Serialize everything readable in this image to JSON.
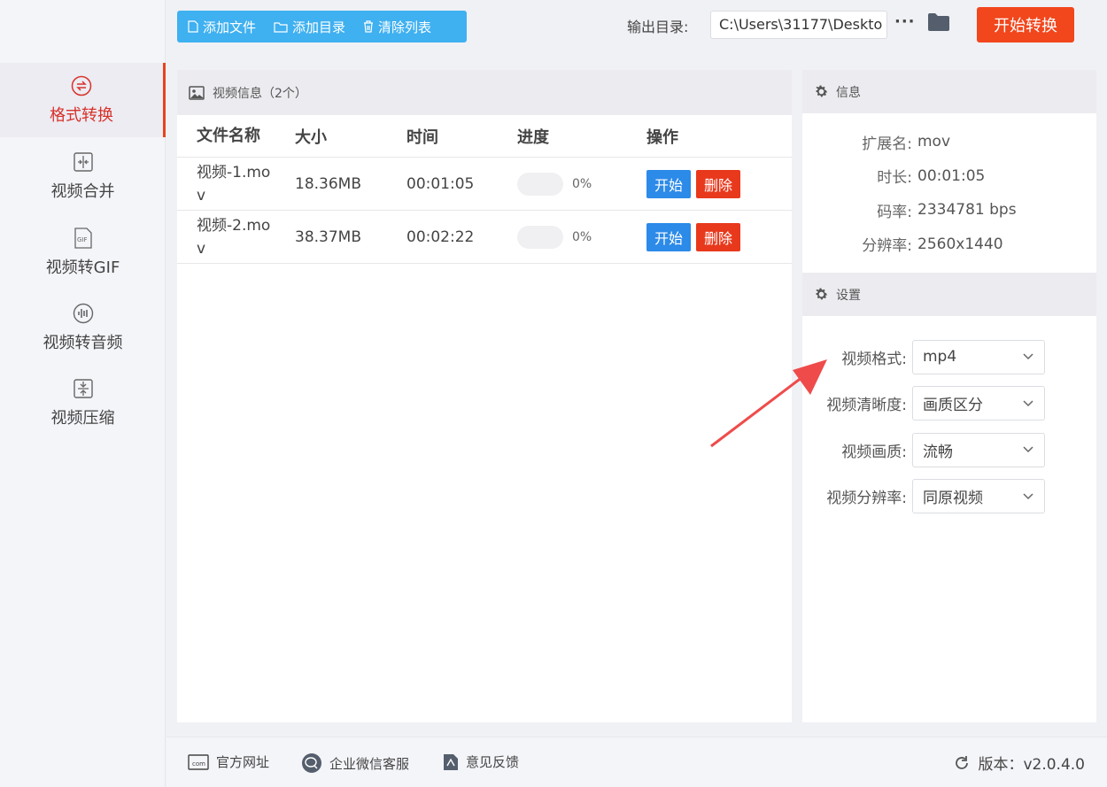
{
  "sidebar": {
    "items": [
      {
        "label": "格式转换",
        "icon": "convert-icon",
        "active": true
      },
      {
        "label": "视频合并",
        "icon": "merge-icon"
      },
      {
        "label": "视频转GIF",
        "icon": "gif-icon",
        "icon_text": "GIF"
      },
      {
        "label": "视频转音频",
        "icon": "audio-icon"
      },
      {
        "label": "视频压缩",
        "icon": "compress-icon"
      }
    ]
  },
  "toolbar": {
    "add_file": "添加文件",
    "add_dir": "添加目录",
    "clear_list": "清除列表",
    "output_label": "输出目录:",
    "output_path": "C:\\Users\\31177\\Deskto",
    "more": "···",
    "start_all": "开始转换"
  },
  "list": {
    "title": "视频信息（2个）",
    "columns": [
      "文件名称",
      "大小",
      "时间",
      "进度",
      "操作"
    ],
    "rows": [
      {
        "name_line1": "视频-1.mo",
        "name_line2": "v",
        "size": "18.36MB",
        "time": "00:01:05",
        "progress": "0%",
        "start": "开始",
        "delete": "删除"
      },
      {
        "name_line1": "视频-2.mo",
        "name_line2": "v",
        "size": "38.37MB",
        "time": "00:02:22",
        "progress": "0%",
        "start": "开始",
        "delete": "删除"
      }
    ]
  },
  "info": {
    "title": "信息",
    "rows": [
      {
        "key": "扩展名:",
        "value": "mov"
      },
      {
        "key": "时长:",
        "value": "00:01:05"
      },
      {
        "key": "码率:",
        "value": "2334781 bps"
      },
      {
        "key": "分辨率:",
        "value": "2560x1440"
      }
    ]
  },
  "settings": {
    "title": "设置",
    "rows": [
      {
        "key": "视频格式:",
        "value": "mp4"
      },
      {
        "key": "视频清晰度:",
        "value": "画质区分"
      },
      {
        "key": "视频画质:",
        "value": "流畅"
      },
      {
        "key": "视频分辨率:",
        "value": "同原视频"
      }
    ]
  },
  "footer": {
    "website": "官方网址",
    "website_icon_text": "com",
    "wechat": "企业微信客服",
    "feedback": "意见反馈",
    "version": "版本：v2.0.4.0"
  },
  "colors": {
    "accent_blue": "#3fb0f0",
    "start_orange": "#f2461c",
    "active_red": "#d8312a",
    "button_blue": "#2c8ae8",
    "delete_red": "#e8391d",
    "arrow_red": "#ef4b4b"
  }
}
